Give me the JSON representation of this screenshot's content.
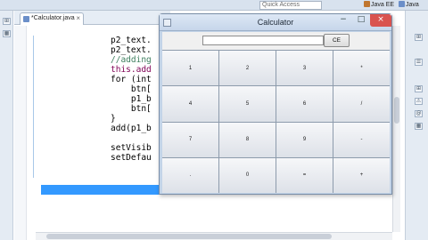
{
  "toolbar": {
    "quick_access_placeholder": "Quick Access",
    "perspectives": [
      "Java EE",
      "Java"
    ],
    "perspective_colors": [
      "#c0762f",
      "#6b8fc9"
    ]
  },
  "editor": {
    "tab_label": "*Calculator.java",
    "tab_close": "×",
    "lines": [
      "p2_text.",
      "p2_text.",
      "//adding",
      "this.add",
      "for (int",
      "    btn[",
      "    p1_b",
      "    btn[",
      "}",
      "add(p1_b",
      "",
      "setVisib",
      "setDefau",
      "}",
      "",
      "/**"
    ],
    "highlight_color": "#3399ff",
    "comment_color": "#3f7f5f",
    "keyword_color": "#7f0055"
  },
  "calculator": {
    "title": "Calculator",
    "min_glyph": "−",
    "max_glyph": "□",
    "close_glyph": "×",
    "display_value": "",
    "ce_label": "CE",
    "keys": [
      "1",
      "2",
      "3",
      "*",
      "4",
      "5",
      "6",
      "/",
      "7",
      "8",
      "9",
      "-",
      ".",
      "0",
      "=",
      "+"
    ]
  }
}
